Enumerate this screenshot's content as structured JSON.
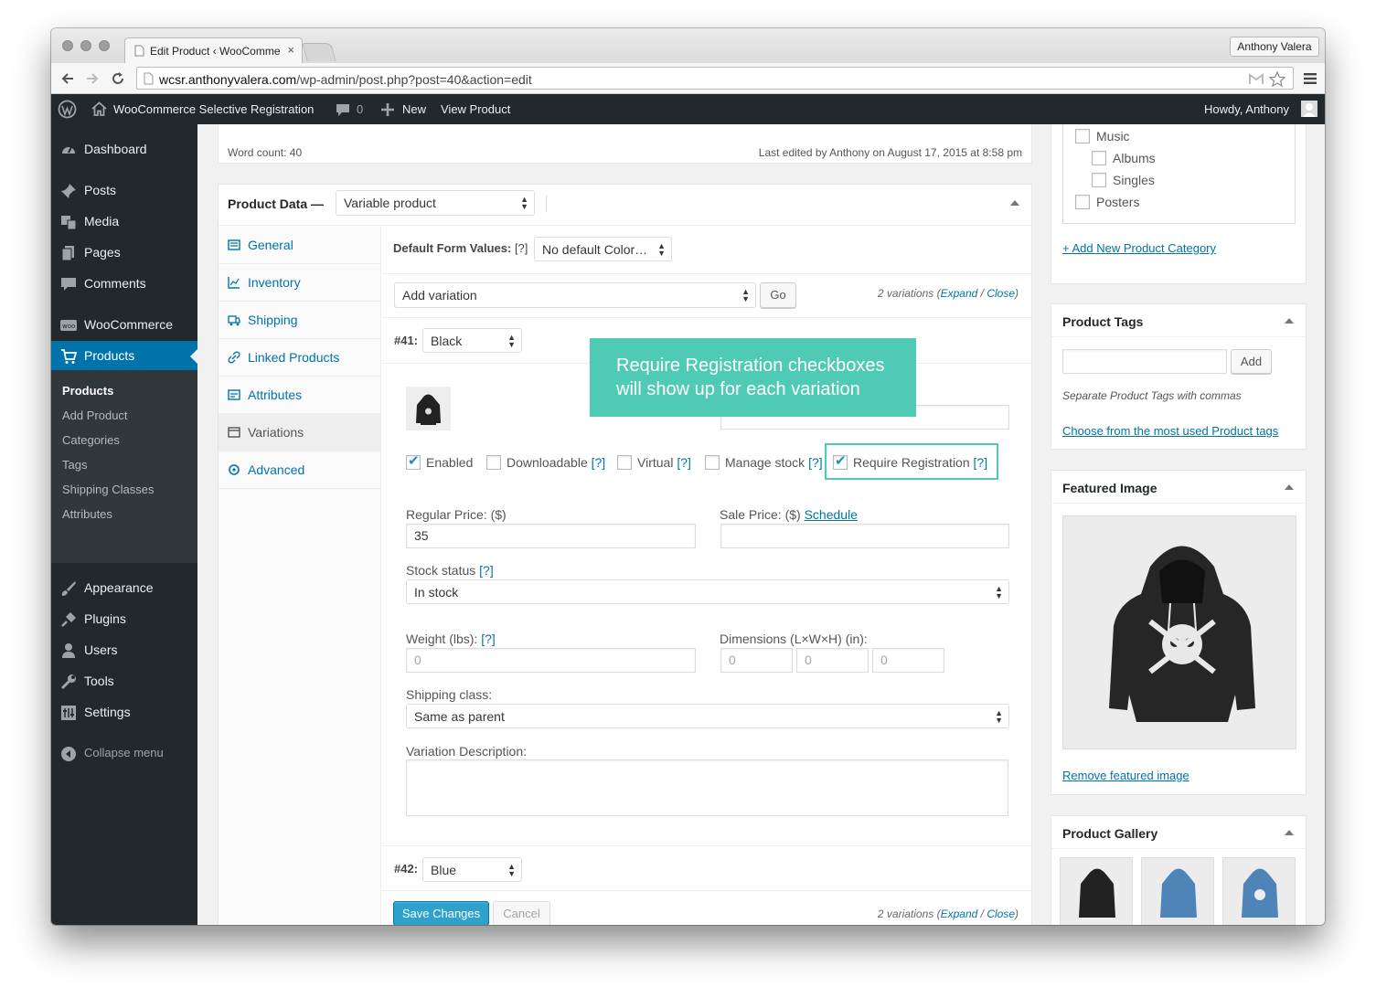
{
  "browser": {
    "tab_title": "Edit Product ‹ WooComme",
    "tab_close": "×",
    "profile": "Anthony Valera",
    "url_domain": "wcsr.anthonyvalera.com",
    "url_path": "/wp-admin/post.php?post=40&action=edit"
  },
  "adminbar": {
    "site_name": "WooCommerce Selective Registration",
    "comments_count": "0",
    "new_label": "New",
    "view_product": "View Product",
    "howdy": "Howdy, Anthony"
  },
  "sidebar": {
    "items": [
      {
        "label": "Dashboard",
        "icon": "dashboard-icon"
      },
      {
        "label": "Posts",
        "icon": "pin-icon"
      },
      {
        "label": "Media",
        "icon": "media-icon"
      },
      {
        "label": "Pages",
        "icon": "pages-icon"
      },
      {
        "label": "Comments",
        "icon": "comment-icon"
      },
      {
        "label": "WooCommerce",
        "icon": "woo-icon"
      },
      {
        "label": "Products",
        "icon": "cart-icon"
      },
      {
        "label": "Appearance",
        "icon": "brush-icon"
      },
      {
        "label": "Plugins",
        "icon": "plugin-icon"
      },
      {
        "label": "Users",
        "icon": "user-icon"
      },
      {
        "label": "Tools",
        "icon": "wrench-icon"
      },
      {
        "label": "Settings",
        "icon": "settings-icon"
      }
    ],
    "submenu": [
      "Products",
      "Add Product",
      "Categories",
      "Tags",
      "Shipping Classes",
      "Attributes"
    ],
    "collapse": "Collapse menu"
  },
  "editor_footer": {
    "word_count": "Word count: 40",
    "last_edited": "Last edited by Anthony on August 17, 2015 at 8:58 pm"
  },
  "product_data": {
    "title": "Product Data —",
    "type_value": "Variable product",
    "tabs": [
      "General",
      "Inventory",
      "Shipping",
      "Linked Products",
      "Attributes",
      "Variations",
      "Advanced"
    ],
    "default_form_label": "Default Form Values:",
    "help": "[?]",
    "default_form_value": "No default Color…",
    "add_variation": "Add variation",
    "go": "Go",
    "variations_count": "2 variations (",
    "expand": "Expand",
    "slash": " / ",
    "close": "Close",
    "paren": ")",
    "variation1": {
      "id": "#41:",
      "color": "Black",
      "checkboxes": {
        "enabled": "Enabled",
        "downloadable": "Downloadable",
        "virtual": "Virtual",
        "manage_stock": "Manage stock",
        "require_registration": "Require Registration"
      },
      "regular_price_label": "Regular Price: ($)",
      "regular_price": "35",
      "sale_price_label": "Sale Price: ($)",
      "schedule": "Schedule",
      "stock_status_label": "Stock status",
      "stock_status": "In stock",
      "weight_label": "Weight (lbs):",
      "weight_placeholder": "0",
      "dimensions_label": "Dimensions (L×W×H) (in):",
      "dim_placeholder": "0",
      "shipping_class_label": "Shipping class:",
      "shipping_class": "Same as parent",
      "description_label": "Variation Description:"
    },
    "variation2": {
      "id": "#42:",
      "color": "Blue"
    },
    "save": "Save Changes",
    "cancel": "Cancel"
  },
  "callout": {
    "line1": "Require Registration checkboxes",
    "line2": "will show up for each variation",
    "color": "#4fcab4"
  },
  "categories": {
    "items": [
      "Music",
      "Albums",
      "Singles",
      "Posters"
    ],
    "add_new": "+ Add New Product Category"
  },
  "tags": {
    "title": "Product Tags",
    "add": "Add",
    "hint": "Separate Product Tags with commas",
    "choose": "Choose from the most used Product tags"
  },
  "featured": {
    "title": "Featured Image",
    "remove": "Remove featured image"
  },
  "gallery": {
    "title": "Product Gallery"
  },
  "colors": {
    "accent": "#0073aa",
    "adminbar": "#23282d",
    "highlight_border": "#4fcab4"
  }
}
